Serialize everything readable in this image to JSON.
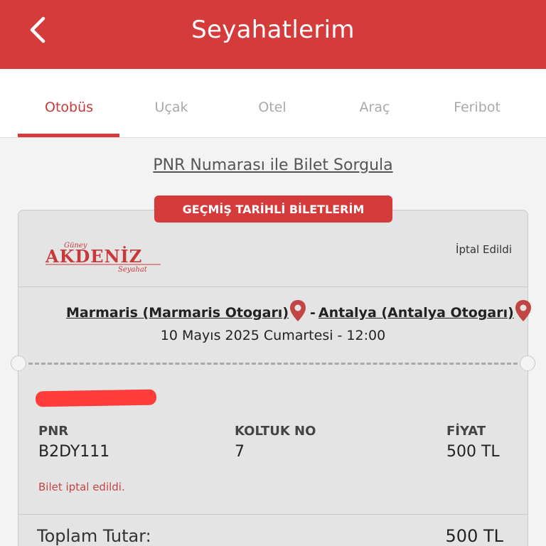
{
  "header": {
    "title": "Seyahatlerim",
    "back_icon": "chevron-left-icon"
  },
  "tabs": [
    {
      "label": "Otobüs",
      "active": true
    },
    {
      "label": "Uçak",
      "active": false
    },
    {
      "label": "Otel",
      "active": false
    },
    {
      "label": "Araç",
      "active": false
    },
    {
      "label": "Feribot",
      "active": false
    }
  ],
  "pnr_query_link": "PNR Numarası ile Bilet Sorgula",
  "section_badge": "GEÇMİŞ TARİHLİ BİLETLERİM",
  "ticket": {
    "company_logo": {
      "top": "Güney",
      "main": "AKDENİZ",
      "bottom": "Seyahat"
    },
    "status": "İptal Edildi",
    "route": {
      "from": "Marmaris (Marmaris Otogarı)",
      "separator": "-",
      "to": "Antalya (Antalya Otogarı)"
    },
    "datetime": "10 Mayıs 2025 Cumartesi - 12:00",
    "fields": {
      "pnr_label": "PNR",
      "pnr_value": "B2DY111",
      "seat_label": "KOLTUK NO",
      "seat_value": "7",
      "price_label": "FİYAT",
      "price_value": "500 TL"
    },
    "cancel_note": "Bilet iptal edildi.",
    "total_label": "Toplam Tutar:",
    "total_value": "500 TL"
  },
  "colors": {
    "brand_red": "#d63b3b",
    "card_bg": "#e4e4e4",
    "page_bg": "#f3f3f3"
  }
}
